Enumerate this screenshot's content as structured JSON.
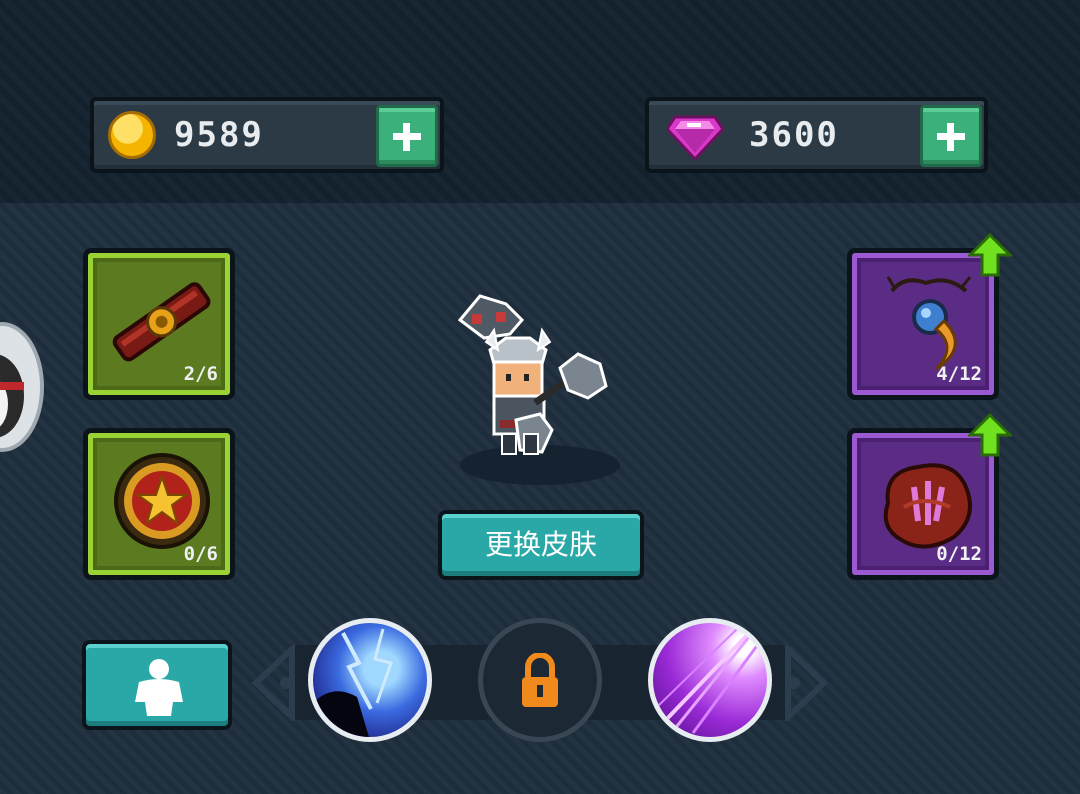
{
  "currency": {
    "gold": {
      "icon": "gold-coin-icon",
      "value": "9589"
    },
    "gems": {
      "icon": "pink-gem-icon",
      "value": "3600"
    }
  },
  "slots": {
    "left_top": {
      "icon": "belt-icon",
      "count": "2/6"
    },
    "left_bottom": {
      "icon": "medal-shield-icon",
      "count": "0/6"
    },
    "right_top": {
      "icon": "moon-amulet-icon",
      "count": "4/12",
      "upgradable": true
    },
    "right_bottom": {
      "icon": "crystal-ore-icon",
      "count": "0/12",
      "upgradable": true
    }
  },
  "buttons": {
    "change_skin": "更换皮肤",
    "character_icon": "character-silhouette-icon"
  },
  "skills": [
    {
      "icon": "lightning-storm-skill-icon",
      "locked": false
    },
    {
      "icon": "lock-icon",
      "locked": true
    },
    {
      "icon": "purple-beam-skill-icon",
      "locked": false
    }
  ],
  "colors": {
    "green_frame": "#9bd233",
    "purple_frame": "#9b5ad1",
    "teal_button": "#2aa8a8",
    "plus_green": "#3bb07a",
    "lock_orange": "#f08a1c",
    "upgrade_arrow": "#6fe11e"
  }
}
